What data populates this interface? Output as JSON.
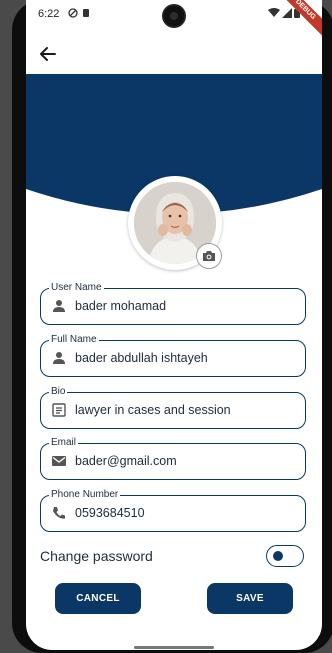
{
  "status": {
    "time": "6:22"
  },
  "debug_banner": "DEBUG",
  "colors": {
    "primary": "#0b3766",
    "background": "#ffffff"
  },
  "icons": {
    "back": "arrow-left-icon",
    "camera": "camera-icon",
    "user": "person-icon",
    "bio": "article-icon",
    "email": "mail-icon",
    "phone": "phone-icon"
  },
  "fields": [
    {
      "label": "User Name",
      "value": "bader mohamad"
    },
    {
      "label": "Full Name",
      "value": "bader abdullah ishtayeh"
    },
    {
      "label": "Bio",
      "value": "lawyer in cases and session"
    },
    {
      "label": "Email",
      "value": "bader@gmail.com"
    },
    {
      "label": "Phone Number",
      "value": "0593684510"
    }
  ],
  "change_password": {
    "label": "Change password",
    "enabled": false
  },
  "actions": {
    "cancel": "CANCEL",
    "save": "SAVE"
  }
}
